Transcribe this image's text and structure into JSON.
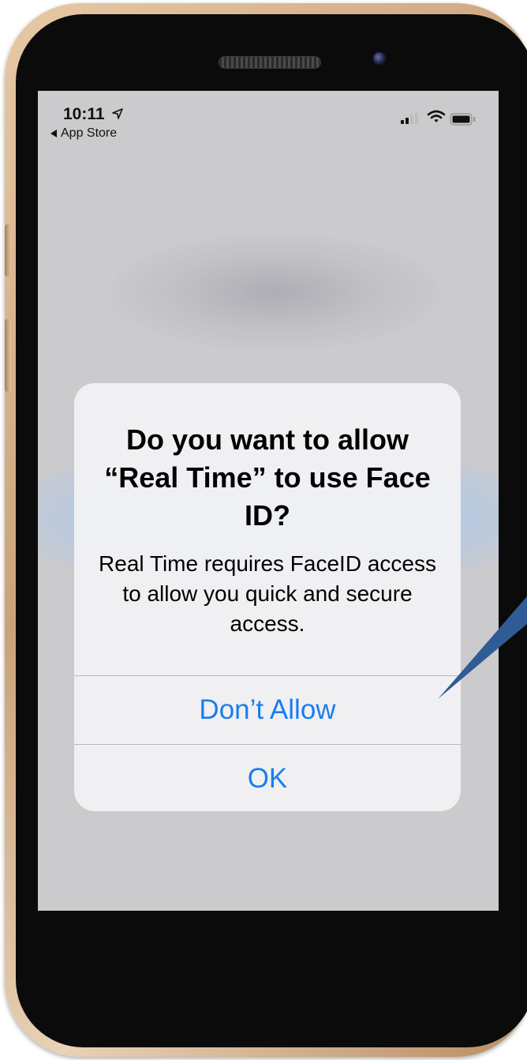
{
  "status_bar": {
    "time": "10:11",
    "back_label": "App Store"
  },
  "dialog": {
    "title": "Do you want to allow “Real Time” to use Face ID?",
    "message": "Real Time requires FaceID access to allow you quick and secure access.",
    "buttons": [
      {
        "label": "Don’t Allow"
      },
      {
        "label": "OK"
      }
    ]
  },
  "colors": {
    "accent": "#1a7ef0",
    "pointer_arrow": "#2f5c95",
    "frame_gold": "#caa27a"
  },
  "icons": {
    "location": "location-arrow-icon",
    "signal": "cellular-signal-icon",
    "wifi": "wifi-icon",
    "battery": "battery-icon"
  }
}
